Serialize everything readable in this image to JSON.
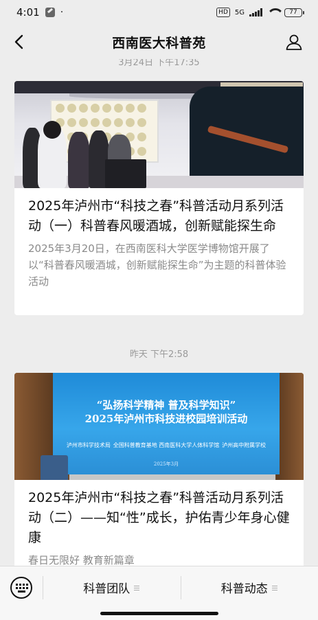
{
  "status_bar": {
    "time": "4:01",
    "dot": "·",
    "hd": "HD",
    "network": "5G",
    "battery": "77"
  },
  "nav": {
    "title": "西南医大科普苑"
  },
  "feed": {
    "timestamp_top": "3月24日 下午17:35",
    "articles": [
      {
        "title": "2025年泸州市“科技之春”科普活动月系列活动（一）科普春风暖酒城，创新赋能探生命",
        "description": "2025年3月20日，在西南医科大学医学博物馆开展了以“科普春风暖酒城，创新赋能探生命”为主题的科普体验活动"
      },
      {
        "timestamp": "昨天 下午2:58",
        "title": "2025年泸州市“科技之春”科普活动月系列活动（二）——知“性”成长，护佑青少年身心健康",
        "description": "春日无限好 教育新篇章",
        "cover_text": {
          "line1": "“弘扬科学精神 普及科学知识”",
          "line2": "2025年泸州市科技进校园培训活动",
          "org1": "泸州市科学技术局",
          "org2": "全国科普教育基地 西南医科大学人体科学馆",
          "org3": "泸州高中附属学校",
          "date": "2025年3月"
        }
      }
    ]
  },
  "bottom_menu": {
    "items": [
      {
        "label": "科普团队"
      },
      {
        "label": "科普动态"
      }
    ]
  }
}
